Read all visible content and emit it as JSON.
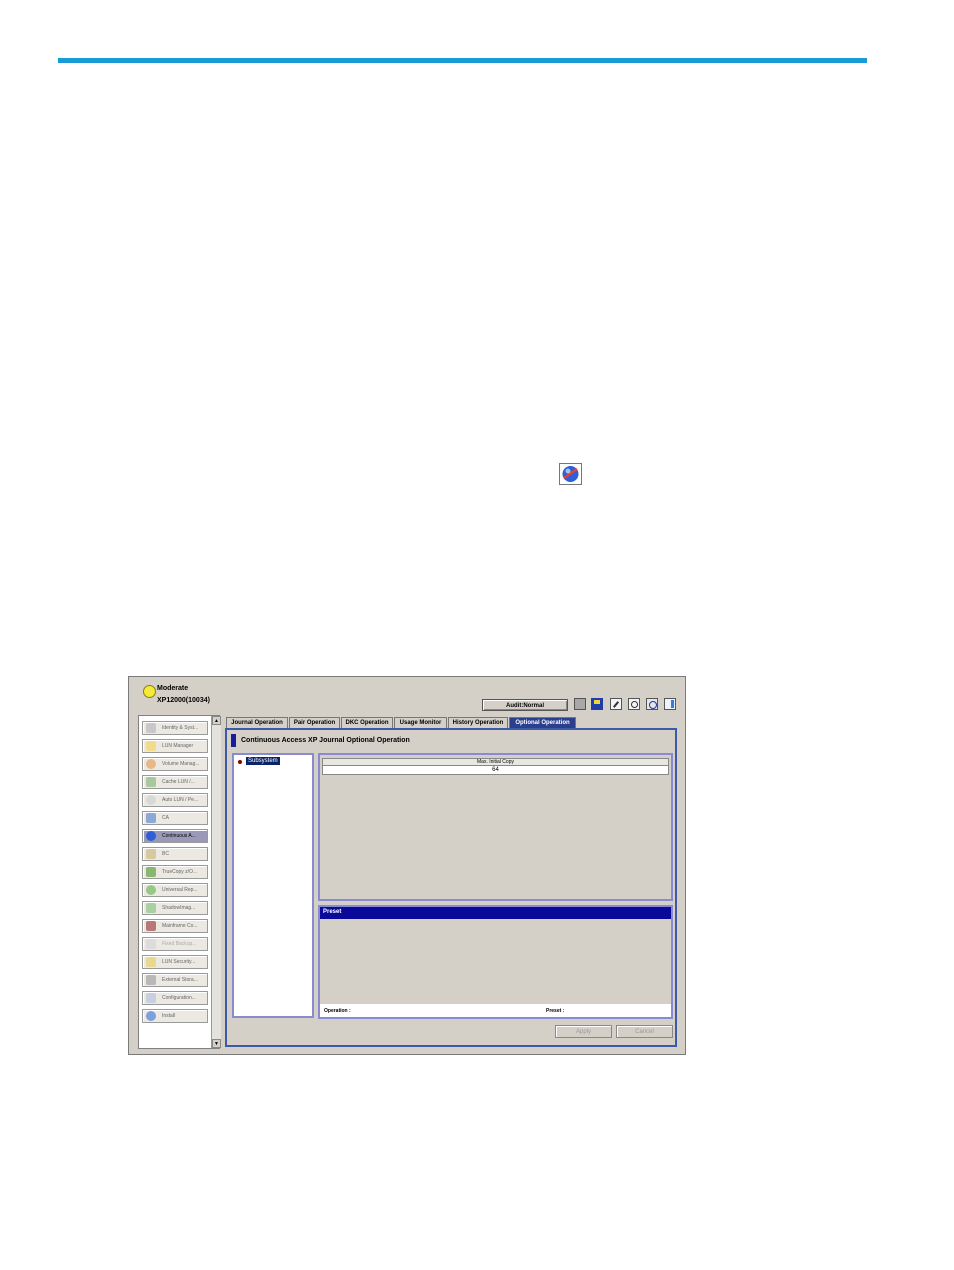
{
  "status": {
    "text": "Moderate",
    "system": "XP12000(10034)"
  },
  "toolbar": {
    "mode_label": "Audit:Normal"
  },
  "sidebar": {
    "items": [
      {
        "label": "Identity & Syst..."
      },
      {
        "label": "LUN Manager"
      },
      {
        "label": "Volume Manag..."
      },
      {
        "label": "Cache LUN /..."
      },
      {
        "label": "Auto LUN / Pe..."
      },
      {
        "label": "CA"
      },
      {
        "label": "Continuous A..."
      },
      {
        "label": "BC"
      },
      {
        "label": "TrueCopy z/O..."
      },
      {
        "label": "Universal Rep..."
      },
      {
        "label": "ShadowImag..."
      },
      {
        "label": "Mainframe Co..."
      },
      {
        "label": "Fixed Backup..."
      },
      {
        "label": "LUN Security..."
      },
      {
        "label": "External Stora..."
      },
      {
        "label": "Configuration..."
      },
      {
        "label": "Install"
      }
    ],
    "scroll_up": "▲",
    "scroll_down": "▼"
  },
  "tabs": [
    {
      "label": "Journal Operation"
    },
    {
      "label": "Pair Operation"
    },
    {
      "label": "DKC Operation"
    },
    {
      "label": "Usage Monitor"
    },
    {
      "label": "History Operation"
    },
    {
      "label": "Optional Operation"
    }
  ],
  "main": {
    "title": "Continuous Access XP Journal Optional Operation",
    "tree_node": "Subsystem",
    "column_header": "Max. Initial Copy",
    "cell_value": "64",
    "preset_title": "Preset",
    "operation_label": "Operation :",
    "preset_label": "Preset :",
    "apply_label": "Apply",
    "cancel_label": "Cancel"
  }
}
